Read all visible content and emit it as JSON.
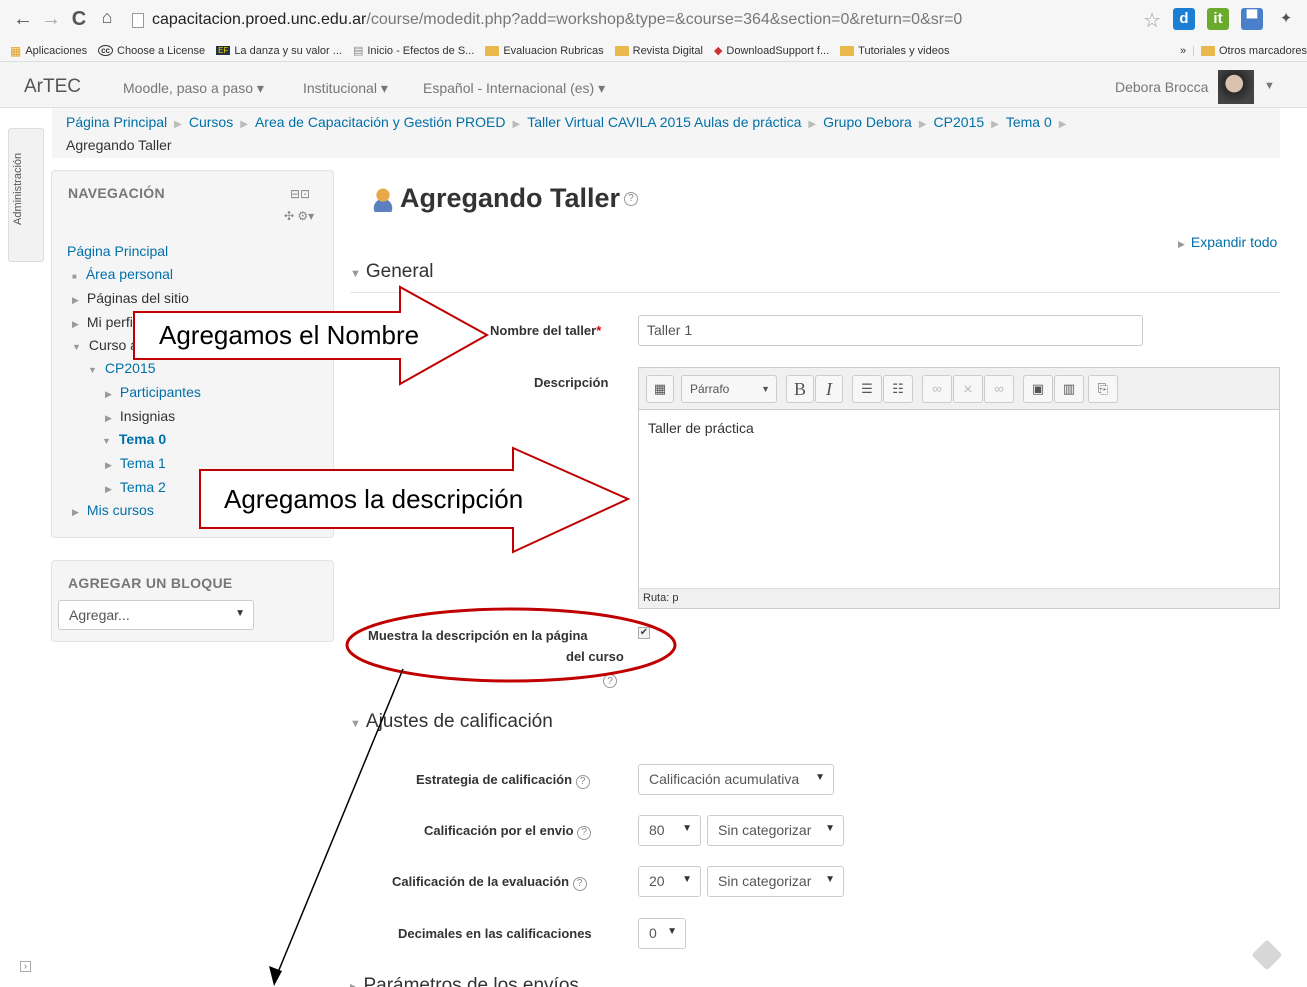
{
  "browser": {
    "url_host": "capacitacion.proed.unc.edu.ar",
    "url_path": "/course/modedit.php?add=workshop&type=&course=364&section=0&return=0&sr=0",
    "bookmarks": [
      "Aplicaciones",
      "Choose a License",
      "La danza y su valor ...",
      "Inicio - Efectos de S...",
      "Evaluacion Rubricas",
      "Revista Digital",
      "DownloadSupport f...",
      "Tutoriales y videos"
    ],
    "more": "»",
    "other_bookmarks": "Otros marcadores"
  },
  "navbar": {
    "brand": "ArTEC",
    "menus": [
      "Moodle, paso a paso ▾",
      "Institucional ▾",
      "Español - Internacional (es) ▾"
    ],
    "user": "Debora Brocca"
  },
  "breadcrumb": {
    "items": [
      "Página Principal",
      "Cursos",
      "Area de Capacitación y Gestión PROED",
      "Taller Virtual CAVILA 2015 Aulas de práctica",
      "Grupo Debora",
      "CP2015",
      "Tema 0"
    ],
    "current": "Agregando Taller"
  },
  "admin_tab": "Administración",
  "nav_block": {
    "title": "NAVEGACIÓN",
    "items": [
      "Página Principal",
      "Área personal",
      "Páginas del sitio",
      "Mi perfil",
      "Curso actual",
      "CP2015",
      "Participantes",
      "Insignias",
      "Tema 0",
      "Tema 1",
      "Tema 2",
      "Mis cursos"
    ]
  },
  "add_block": {
    "title": "AGREGAR UN BLOQUE",
    "select": "Agregar..."
  },
  "page": {
    "title": "Agregando Taller",
    "expand_all": "Expandir todo",
    "section_general": "General",
    "section_grading": "Ajustes de calificación",
    "section_submission": "Parámetros de los envíos"
  },
  "form": {
    "name_label": "Nombre del taller",
    "name_value": "Taller 1",
    "desc_label": "Descripción",
    "paragraph_select": "Párrafo",
    "desc_value": "Taller de práctica",
    "path": "Ruta: p",
    "show_desc_label_1": "Muestra la descripción en la página",
    "show_desc_label_2": "del curso",
    "strategy_label": "Estrategia de calificación",
    "strategy_value": "Calificación acumulativa",
    "sub_grade_label": "Calificación por el envio",
    "sub_grade_value": "80",
    "sub_cat_value": "Sin categorizar",
    "eval_grade_label": "Calificación de la evaluación",
    "eval_grade_value": "20",
    "eval_cat_value": "Sin categorizar",
    "decimals_label": "Decimales en las calificaciones",
    "decimals_value": "0"
  },
  "annotations": {
    "name_arrow": "Agregamos el Nombre",
    "desc_arrow": "Agregamos la descripción"
  }
}
